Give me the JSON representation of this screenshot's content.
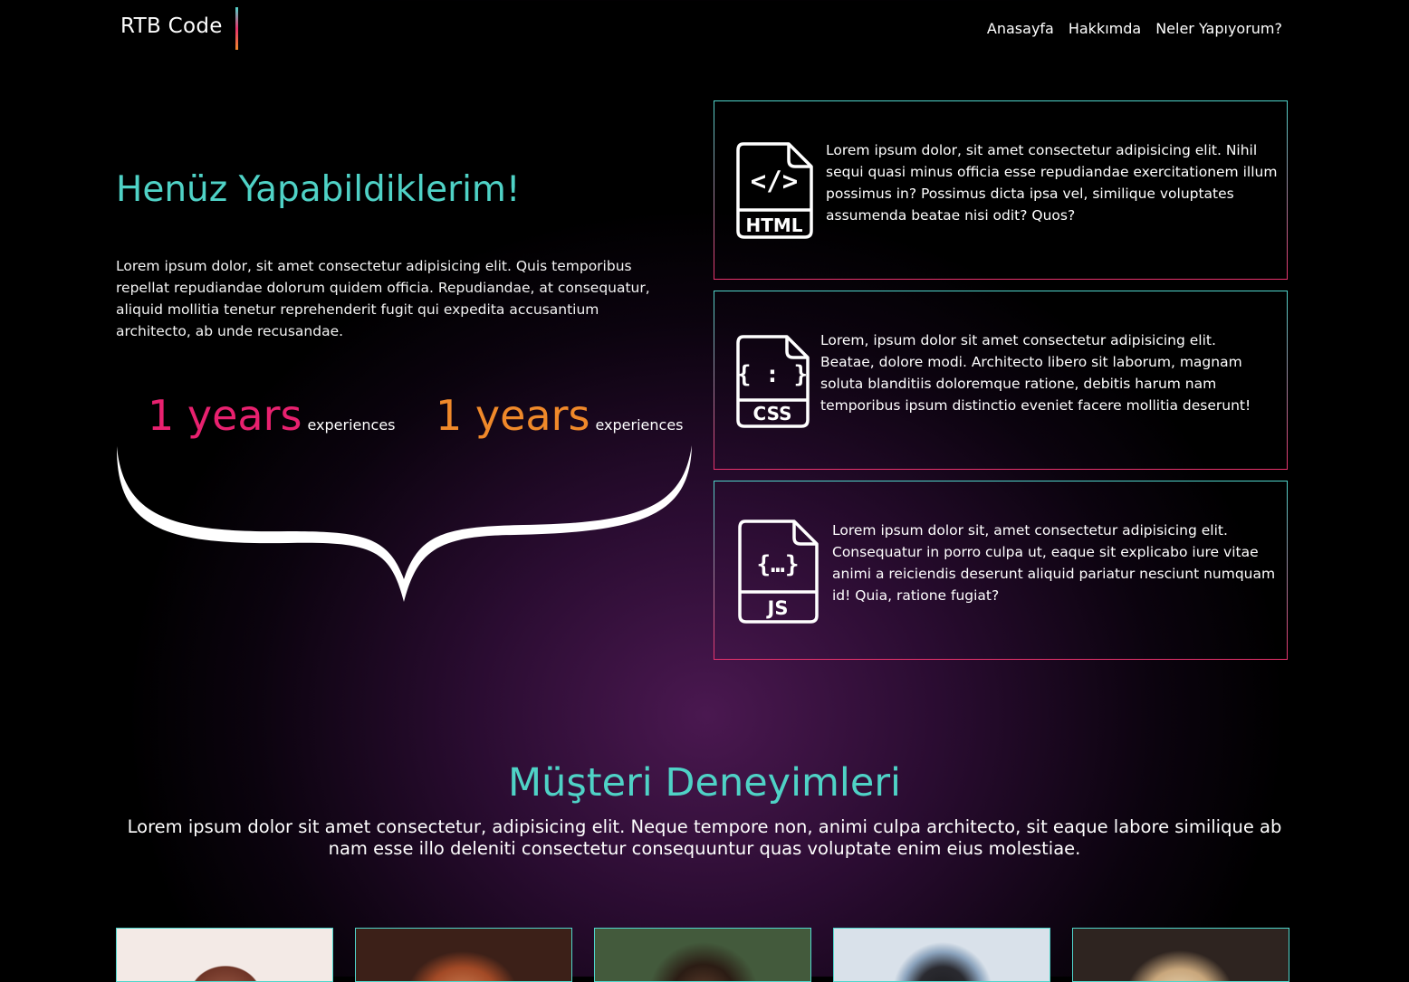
{
  "nav": {
    "logo": "RTB Code",
    "links": [
      "Anasayfa",
      "Hakkımda",
      "Neler Yapıyorum?"
    ]
  },
  "hero": {
    "title": "Henüz Yapabildiklerim!",
    "text": "Lorem ipsum dolor, sit amet consectetur adipisicing elit. Quis temporibus repellat repudiandae dolorum quidem officia. Repudiandae, at consequatur, aliquid mollitia tenetur reprehenderit fugit qui expedita accusantium architecto, ab unde recusandae.",
    "stats": [
      {
        "value": "1 years",
        "label": "experiences",
        "color": "#e8216f"
      },
      {
        "value": "1 years",
        "label": "experiences",
        "color": "#f0892a"
      }
    ]
  },
  "skills": [
    {
      "icon": "html-file-icon",
      "badge": "HTML",
      "symbol": "</>",
      "text": "Lorem ipsum dolor, sit amet consectetur adipisicing elit. Nihil sequi quasi minus officia esse repudiandae exercitationem illum possimus in? Possimus dicta ipsa vel, similique voluptates assumenda beatae nisi odit? Quos?"
    },
    {
      "icon": "css-file-icon",
      "badge": "CSS",
      "symbol": "{ : }",
      "text": "Lorem, ipsum dolor sit amet consectetur adipisicing elit. Beatae, dolore modi. Architecto libero sit laborum, magnam soluta blanditiis doloremque ratione, debitis harum nam temporibus ipsum distinctio eveniet facere mollitia deserunt!"
    },
    {
      "icon": "js-file-icon",
      "badge": "JS",
      "symbol": "{…}",
      "text": "Lorem ipsum dolor sit, amet consectetur adipisicing elit. Consequatur in porro culpa ut, eaque sit explicabo iure vitae animi a reiciendis deserunt aliquid pariatur nesciunt numquam id! Quia, ratione fugiat?"
    }
  ],
  "testimonials": {
    "title": "Müşteri Deneyimleri",
    "text": "Lorem ipsum dolor sit amet consectetur, adipisicing elit. Neque tempore non, animi culpa architecto, sit eaque labore similique ab nam esse illo deleniti consectetur consequuntur quas voluptate enim eius molestiae."
  },
  "colors": {
    "accent": "#4fd2c6",
    "pink": "#e8336d",
    "orange": "#f0892a"
  }
}
